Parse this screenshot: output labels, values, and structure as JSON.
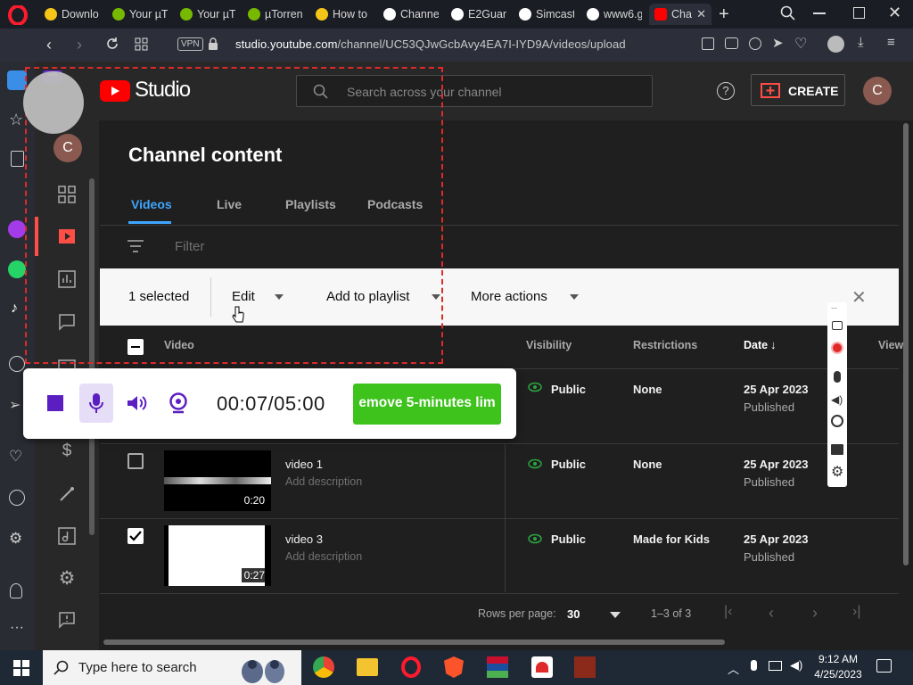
{
  "browser": {
    "tabs": [
      {
        "label": "Downlo",
        "color": "#f5c518"
      },
      {
        "label": "Your µT",
        "color": "#76b900"
      },
      {
        "label": "Your µT",
        "color": "#76b900"
      },
      {
        "label": "µTorren",
        "color": "#76b900"
      },
      {
        "label": "How to",
        "color": "#f5c518"
      },
      {
        "label": "Channe",
        "color": "#ffffff"
      },
      {
        "label": "E2Guar",
        "color": "#ffffff"
      },
      {
        "label": "Simcast",
        "color": "#ffffff"
      },
      {
        "label": "www6.g",
        "color": "#ffffff"
      },
      {
        "label": "Cha",
        "color": "#ff0000"
      }
    ],
    "vpn_label": "VPN",
    "url_host": "studio.youtube.com",
    "url_path": "/channel/UC53QJwGcbAvy4EA7I-IYD9A/videos/upload",
    "url_prefix": "studio."
  },
  "header": {
    "logo_text": "Studio",
    "search_placeholder": "Search across your channel",
    "create_label": "CREATE",
    "avatar_letter": "C"
  },
  "nav": {
    "avatar_letter": "C"
  },
  "content": {
    "title": "Channel content",
    "tabs": [
      "Videos",
      "Live",
      "Playlists",
      "Podcasts"
    ],
    "filter_placeholder": "Filter"
  },
  "selection_bar": {
    "count": "1 selected",
    "edit": "Edit",
    "add_to_playlist": "Add to playlist",
    "more_actions": "More actions"
  },
  "table": {
    "headers": {
      "video": "Video",
      "visibility": "Visibility",
      "restrictions": "Restrictions",
      "date": "Date",
      "views": "View"
    },
    "rows": [
      {
        "title": "",
        "description": "",
        "duration": "",
        "visibility": "Public",
        "restrictions": "None",
        "date": "25 Apr 2023",
        "status": "Published",
        "checked": false
      },
      {
        "title": "video 1",
        "description": "Add description",
        "duration": "0:20",
        "visibility": "Public",
        "restrictions": "None",
        "date": "25 Apr 2023",
        "status": "Published",
        "checked": false
      },
      {
        "title": "video 3",
        "description": "Add description",
        "duration": "0:27",
        "visibility": "Public",
        "restrictions": "Made for Kids",
        "date": "25 Apr 2023",
        "status": "Published",
        "checked": true
      }
    ]
  },
  "pagination": {
    "rows_per_page_label": "Rows per page:",
    "rows_per_page_value": "30",
    "range": "1–3 of 3"
  },
  "recorder": {
    "timer": "00:07/05:00",
    "upgrade_label": "emove 5-minutes lim",
    "upgrade_color": "#3ec21c"
  },
  "taskbar": {
    "search_placeholder": "Type here to search",
    "time": "9:12 AM",
    "date": "4/25/2023"
  },
  "colors": {
    "accent": "#3ea6ff",
    "youtube_red": "#ff0000",
    "create_red": "#ff4e45"
  }
}
